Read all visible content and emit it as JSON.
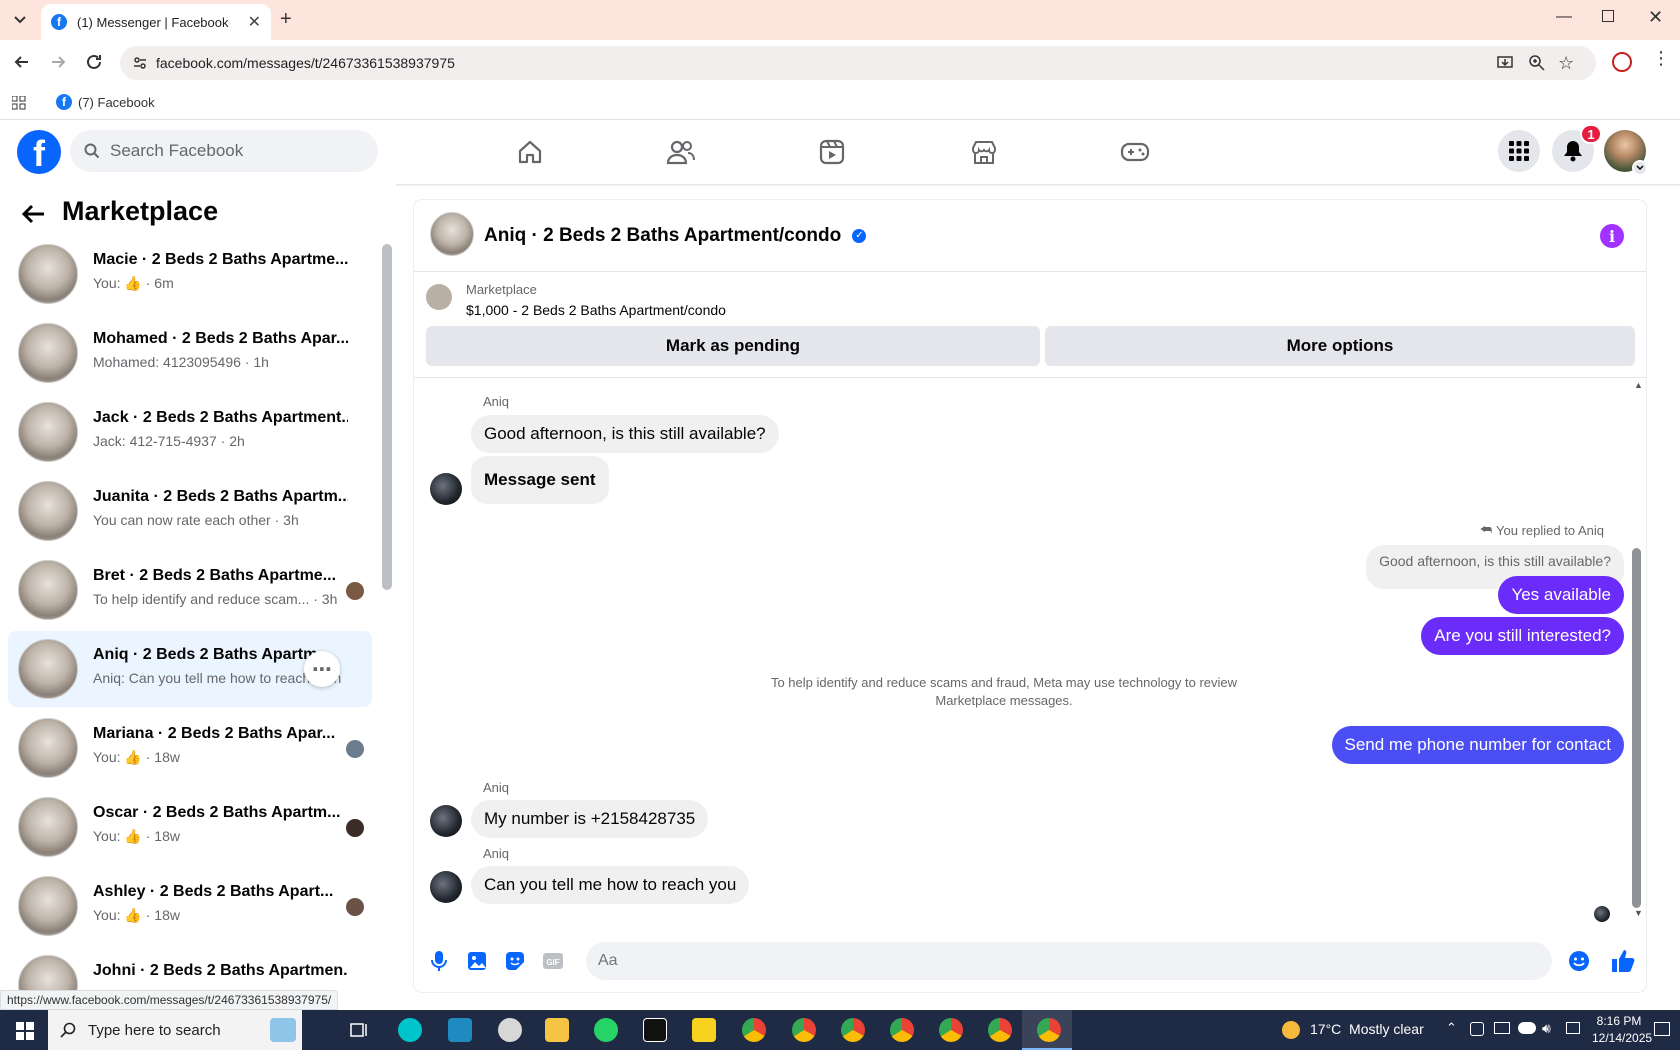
{
  "browser": {
    "tab_title": "(1) Messenger | Facebook",
    "url": "facebook.com/messages/t/24673361538937975",
    "bookmark": "(7) Facebook",
    "status_url": "https://www.facebook.com/messages/t/24673361538937975/"
  },
  "fbnav": {
    "search_placeholder": "Search Facebook",
    "notification_count": "1"
  },
  "sidebar": {
    "title": "Marketplace",
    "conversations": [
      {
        "name": "Macie · 2 Beds 2 Baths Apartme...",
        "preview": "You:",
        "time": "6m",
        "liked": true
      },
      {
        "name": "Mohamed · 2 Beds 2 Baths Apar...",
        "preview": "Mohamed: 4123095496 · 1h",
        "time": "",
        "liked": false
      },
      {
        "name": "Jack · 2 Beds 2 Baths Apartment...",
        "preview": "Jack: 412-715-4937 · 2h",
        "time": "",
        "liked": false
      },
      {
        "name": "Juanita · 2 Beds 2 Baths Apartm...",
        "preview": "You can now rate each other · 3h",
        "time": "",
        "liked": false
      },
      {
        "name": "Bret · 2 Beds 2 Baths Apartme...",
        "preview": "To help identify and reduce scam... · 3h",
        "time": "",
        "liked": false
      },
      {
        "name": "Aniq · 2 Beds 2 Baths Apartm...",
        "preview": "Aniq: Can you tell me how to reach... 3h",
        "time": "",
        "liked": false
      },
      {
        "name": "Mariana · 2 Beds 2 Baths Apar...",
        "preview": "You:",
        "time": "18w",
        "liked": true
      },
      {
        "name": "Oscar · 2 Beds 2 Baths Apartm...",
        "preview": "You:",
        "time": "18w",
        "liked": true
      },
      {
        "name": "Ashley · 2 Beds 2 Baths Apart...",
        "preview": "You:",
        "time": "18w",
        "liked": true
      },
      {
        "name": "Johni · 2 Beds 2 Baths Apartmen...",
        "preview": "",
        "time": "",
        "liked": false
      }
    ]
  },
  "chat": {
    "title": "Aniq · 2 Beds 2 Baths Apartment/condo",
    "listing_source": "Marketplace",
    "listing_title": "$1,000 - 2 Beds 2 Baths Apartment/condo",
    "mark_pending": "Mark as pending",
    "more_options": "More options",
    "sender_name": "Aniq",
    "msg1": "Good afternoon, is this still available?",
    "msg2": "Message sent",
    "replied_label": "You replied to Aniq",
    "quoted": "Good afternoon, is this still available?",
    "out1": "Yes available",
    "out2": "Are you still interested?",
    "notice": "To help identify and reduce scams and fraud, Meta may use technology to review Marketplace messages.",
    "out3": "Send me phone number for contact",
    "msg3": "My number is +2158428735",
    "msg4": "Can you tell me how to reach you",
    "composer_placeholder": "Aa"
  },
  "taskbar": {
    "search_placeholder": "Type here to search",
    "weather": "17°C  Mostly clear",
    "time": "8:16 PM",
    "date": "12/14/2025"
  },
  "colors": {
    "fb_blue": "#0866ff",
    "outgoing_purple": "#6b2cfa",
    "outgoing_blue": "#4b4ef5",
    "active_row": "#ebf5ff"
  }
}
